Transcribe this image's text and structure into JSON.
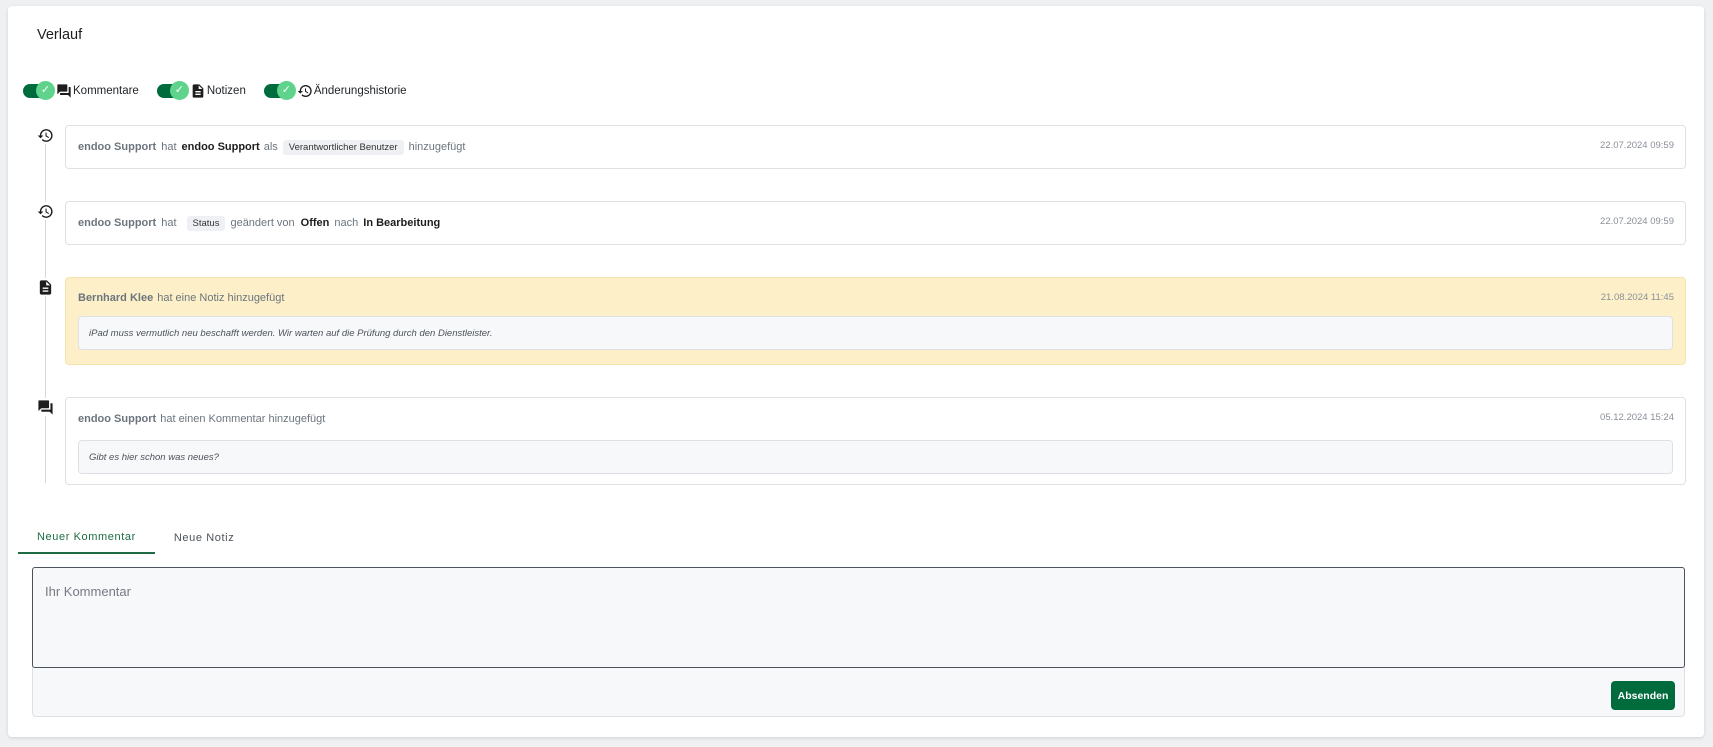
{
  "title": "Verlauf",
  "filters": [
    {
      "label": "Kommentare",
      "icon": "comment-icon",
      "enabled": true
    },
    {
      "label": "Notizen",
      "icon": "note-icon",
      "enabled": true
    },
    {
      "label": "Änderungshistorie",
      "icon": "history-icon",
      "enabled": true
    }
  ],
  "events": [
    {
      "type": "history",
      "icon": "history-icon",
      "actor": "endoo Support",
      "w1": "hat",
      "target": "endoo Support",
      "w2": "als",
      "field": "Verantwortlicher Benutzer",
      "w3": "hinzugefügt",
      "time": "22.07.2024 09:59"
    },
    {
      "type": "history",
      "icon": "history-icon",
      "actor": "endoo Support",
      "w1": "hat",
      "field": "Status",
      "w2": "geändert von",
      "from": "Offen",
      "w3": "nach",
      "to": "In Bearbeitung",
      "time": "22.07.2024 09:59"
    },
    {
      "type": "note",
      "icon": "note-icon",
      "actor": "Bernhard Klee",
      "action": "hat eine Notiz hinzugefügt",
      "time": "21.08.2024 11:45",
      "text": "iPad muss vermutlich neu beschafft werden. Wir warten auf die Prüfung durch den Dienstleister."
    },
    {
      "type": "comment",
      "icon": "comment-icon",
      "actor": "endoo Support",
      "action": "hat einen Kommentar hinzugefügt",
      "time": "05.12.2024 15:24",
      "text": "Gibt es hier schon was neues?"
    }
  ],
  "tabs": [
    {
      "label": "Neuer Kommentar",
      "active": true
    },
    {
      "label": "Neue Notiz",
      "active": false
    }
  ],
  "editor": {
    "placeholder": "Ihr Kommentar",
    "submit_label": "Absenden"
  },
  "colors": {
    "accent": "#006b3c",
    "switch_knob": "#5fd38b",
    "note_bg": "#fdf0c8"
  }
}
